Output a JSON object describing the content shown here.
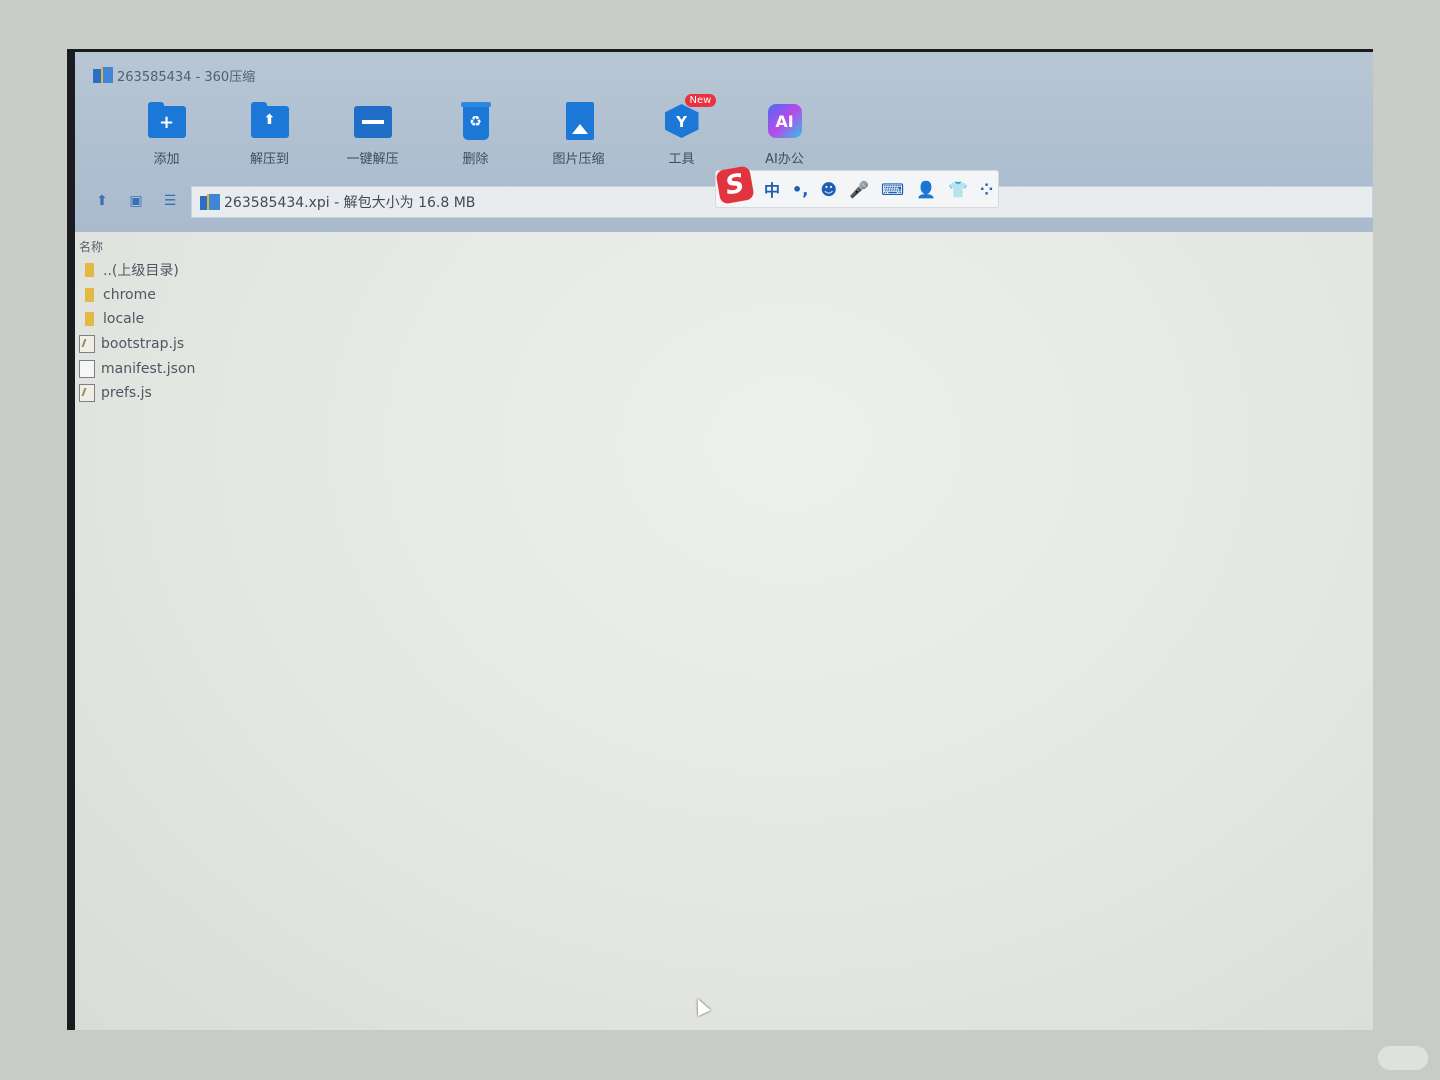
{
  "window": {
    "title": "263585434 - 360压缩",
    "accent": "#1b78d7"
  },
  "toolbar": {
    "items": [
      {
        "label": "添加",
        "icon": "add-folder-icon"
      },
      {
        "label": "解压到",
        "icon": "extract-to-icon"
      },
      {
        "label": "一键解压",
        "icon": "one-click-extract-icon"
      },
      {
        "label": "删除",
        "icon": "delete-icon"
      },
      {
        "label": "图片压缩",
        "icon": "image-compress-icon"
      },
      {
        "label": "工具",
        "icon": "tools-icon",
        "badge": "New"
      },
      {
        "label": "AI办公",
        "icon": "ai-office-icon",
        "glyph": "AI"
      }
    ]
  },
  "addressbar": {
    "path": "263585434.xpi - 解包大小为 16.8 MB"
  },
  "ime": {
    "logo": "S",
    "mode": "中",
    "punct": "•,",
    "emoji": "☻",
    "voice": "🎤",
    "keyboard": "⌨",
    "account": "👤",
    "skin": "👕",
    "apps": "⁘"
  },
  "filelist": {
    "header": "名称",
    "rows": [
      {
        "name": "..(上级目录)",
        "type": "folder"
      },
      {
        "name": "chrome",
        "type": "folder"
      },
      {
        "name": "locale",
        "type": "folder"
      },
      {
        "name": "bootstrap.js",
        "type": "js"
      },
      {
        "name": "manifest.json",
        "type": "file"
      },
      {
        "name": "prefs.js",
        "type": "js"
      }
    ]
  }
}
